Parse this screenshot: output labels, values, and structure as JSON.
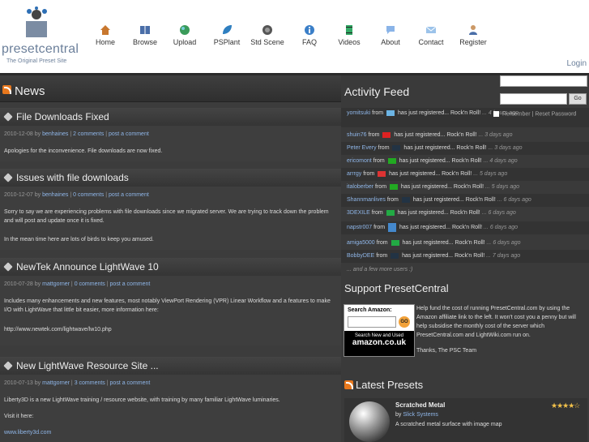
{
  "logo": {
    "name": "presetcentral",
    "tagline": "The Original Preset Site"
  },
  "nav": [
    {
      "label": "Home",
      "icon": "home-icon"
    },
    {
      "label": "Browse",
      "icon": "book-icon"
    },
    {
      "label": "Upload",
      "icon": "globe-icon"
    },
    {
      "label": "PSPlant",
      "icon": "leaf-icon"
    },
    {
      "label": "Std Scene",
      "icon": "scene-icon"
    },
    {
      "label": "FAQ",
      "icon": "info-icon"
    },
    {
      "label": "Videos",
      "icon": "film-icon"
    },
    {
      "label": "About",
      "icon": "speech-icon"
    },
    {
      "label": "Contact",
      "icon": "mail-icon"
    },
    {
      "label": "Register",
      "icon": "user-icon"
    }
  ],
  "login": {
    "label": "Login",
    "go": "Go",
    "remember": "Remember",
    "reset": "Reset Password"
  },
  "news": {
    "title": "News",
    "posts": [
      {
        "title": "File Downloads Fixed",
        "date": "2010-12-08",
        "author": "benhaines",
        "comments": "2 comments",
        "post_comment": "post a comment",
        "body": [
          "Apologies for the inconvenience. File downloads are now fixed."
        ]
      },
      {
        "title": "Issues with file downloads",
        "date": "2010-12-07",
        "author": "benhaines",
        "comments": "0 comments",
        "post_comment": "post a comment",
        "body": [
          "Sorry to say we are experiencing problems with file downloads since we migrated server. We are trying to track down the problem and will post and update once it is fixed.",
          "In the mean time here are lots of birds to keep you amused."
        ]
      },
      {
        "title": "NewTek Announce LightWave 10",
        "date": "2010-07-28",
        "author": "mattgorner",
        "comments": "0 comments",
        "post_comment": "post a comment",
        "body": [
          "Includes many enhancements and new features, most notably ViewPort Rendering (VPR) Linear Workflow and a features to make I/O with LightWave that little bit easier, more information here:",
          "http://www.newtek.com/lightwave/lw10.php"
        ]
      },
      {
        "title": "New LightWave Resource Site ...",
        "date": "2010-07-13",
        "author": "mattgorner",
        "comments": "3 comments",
        "post_comment": "post a comment",
        "body": [
          "Liberty3D is a new LightWave training / resource website, with training by many familiar LightWave luminaries.",
          "Visit it here:",
          "www.liberty3d.com"
        ]
      }
    ]
  },
  "activity": {
    "title": "Activity Feed",
    "items": [
      {
        "user": "yomitsuki",
        "text": "has just registered... Rock'n Roll!",
        "ago": "... 4 hours ago",
        "flag": "#6cb4e4"
      },
      {
        "user": "shuin76",
        "text": "has just registered... Rock'n Roll!",
        "ago": "... 3 days ago",
        "flag": "#d22"
      },
      {
        "user": "Peter Every",
        "text": "has just registered... Rock'n Roll!",
        "ago": "... 3 days ago",
        "flag": "#234"
      },
      {
        "user": "ericomont",
        "text": "has just registered... Rock'n Roll!",
        "ago": "... 4 days ago",
        "flag": "#2a2"
      },
      {
        "user": "arrrgy",
        "text": "has just registered... Rock'n Roll!",
        "ago": "... 5 days ago",
        "flag": "#d33"
      },
      {
        "user": "italoberber",
        "text": "has just registered... Rock'n Roll!",
        "ago": "... 5 days ago",
        "flag": "#2a2"
      },
      {
        "user": "Shannmanlives",
        "text": "has just registered... Rock'n Roll!",
        "ago": "... 6 days ago",
        "flag": "#234"
      },
      {
        "user": "3DEXILE",
        "text": "has just registered... Rock'n Roll!",
        "ago": "... 6 days ago",
        "flag": "#2a4"
      },
      {
        "user": "napstr007",
        "text": "has just registered... Rock'n Roll!",
        "ago": "... 6 days ago",
        "flag": "#48c"
      },
      {
        "user": "amiga5000",
        "text": "has just registered... Rock'n Roll!",
        "ago": "... 6 days ago",
        "flag": "#2a4"
      },
      {
        "user": "BobbyDEE",
        "text": "has just registered... Rock'n Roll!",
        "ago": "... 7 days ago",
        "flag": "#234"
      }
    ],
    "more": "... and a few more users :)"
  },
  "support": {
    "title": "Support PresetCentral",
    "amazon_label": "Search Amazon:",
    "amazon_go": "GO",
    "amazon_banner_1": "Search New and Used",
    "amazon_banner_2": "amazon.co.uk",
    "text": "Help fund the cost of running PresetCentral.com by using the Amazon affiliate link to the left. It won't cost you a penny but will help subsidise the monthly cost of the server which PresetCentral.com and LightWiki.com run on.",
    "thanks": "Thanks, The PSC Team"
  },
  "latest": {
    "title": "Latest Presets",
    "preset_name": "Scratched Metal",
    "by": "by",
    "author": "Slick Systems",
    "desc": "A scratched metal surface with image map",
    "stars": "★★★★☆"
  }
}
